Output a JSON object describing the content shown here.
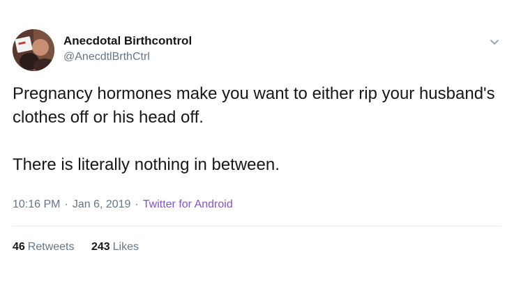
{
  "author": {
    "name": "Anecdotal Birthcontrol",
    "handle": "@AnecdtlBrthCtrl"
  },
  "tweet": {
    "paragraph_1": "Pregnancy hormones make you want to either rip your husband's clothes off or his head off.",
    "paragraph_2": "There is literally nothing in between."
  },
  "meta": {
    "time": "10:16 PM",
    "separator": "·",
    "date": "Jan 6, 2019",
    "source": "Twitter for Android"
  },
  "stats": {
    "retweets_count": "46",
    "retweets_label": "Retweets",
    "likes_count": "243",
    "likes_label": "Likes"
  },
  "colors": {
    "text": "#14171a",
    "secondary": "#657786",
    "source_link": "#8553c8",
    "divider": "#e6ecf0"
  },
  "icons": {
    "menu": "chevron-down-icon"
  }
}
